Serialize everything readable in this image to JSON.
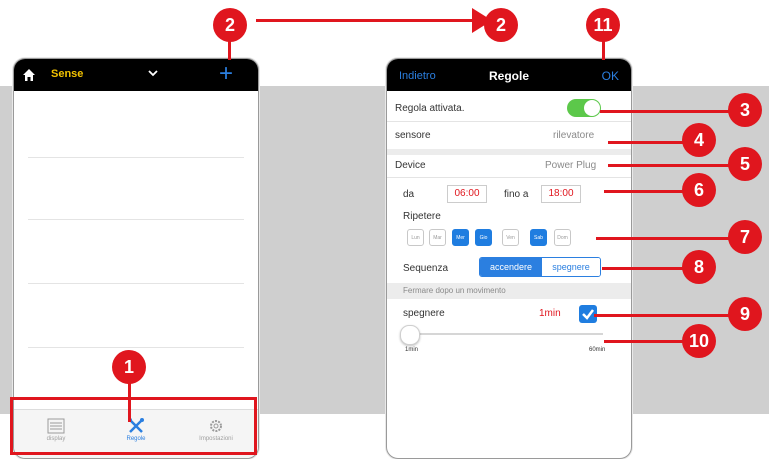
{
  "colors": {
    "accent": "#2b7fe0",
    "badge": "#e0161e",
    "toggle_on": "#5cc84a",
    "brand_yellow": "#f2c200"
  },
  "left_phone": {
    "selector_value": "Sense",
    "icons": {
      "home": "home-icon",
      "dropdown": "chevron-down-icon",
      "add": "plus-icon"
    },
    "tabs": [
      {
        "label": "display",
        "icon": "list-icon"
      },
      {
        "label": "Regole",
        "icon": "tools-icon"
      },
      {
        "label": "Impostazioni",
        "icon": "gear-icon"
      }
    ]
  },
  "right_phone": {
    "back_label": "Indietro",
    "title": "Regole",
    "ok_label": "OK",
    "rule_enabled_label": "Regola attivata.",
    "sensor_label": "sensore",
    "sensor_value": "rilevatore",
    "device_label": "Device",
    "device_value": "Power Plug",
    "from_label": "da",
    "from_time": "06:00",
    "to_label": "fino a",
    "to_time": "18:00",
    "repeat_label": "Ripetere",
    "days": [
      {
        "label": "Lun",
        "on": false
      },
      {
        "label": "Mar",
        "on": false
      },
      {
        "label": "Mer",
        "on": true
      },
      {
        "label": "Gio",
        "on": true
      },
      {
        "label": "Ven",
        "on": false
      },
      {
        "label": "Sab",
        "on": true
      },
      {
        "label": "Dom",
        "on": false
      }
    ],
    "sequence_label": "Sequenza",
    "sequence_options": [
      "accendere",
      "spegnere"
    ],
    "stop_after_label": "Fermare dopo un movimento",
    "off_label": "spegnere",
    "off_value": "1min",
    "slider_min": "1min",
    "slider_max": "60min"
  },
  "callouts": [
    "1",
    "2",
    "2",
    "3",
    "4",
    "5",
    "6",
    "7",
    "8",
    "9",
    "10",
    "11"
  ]
}
